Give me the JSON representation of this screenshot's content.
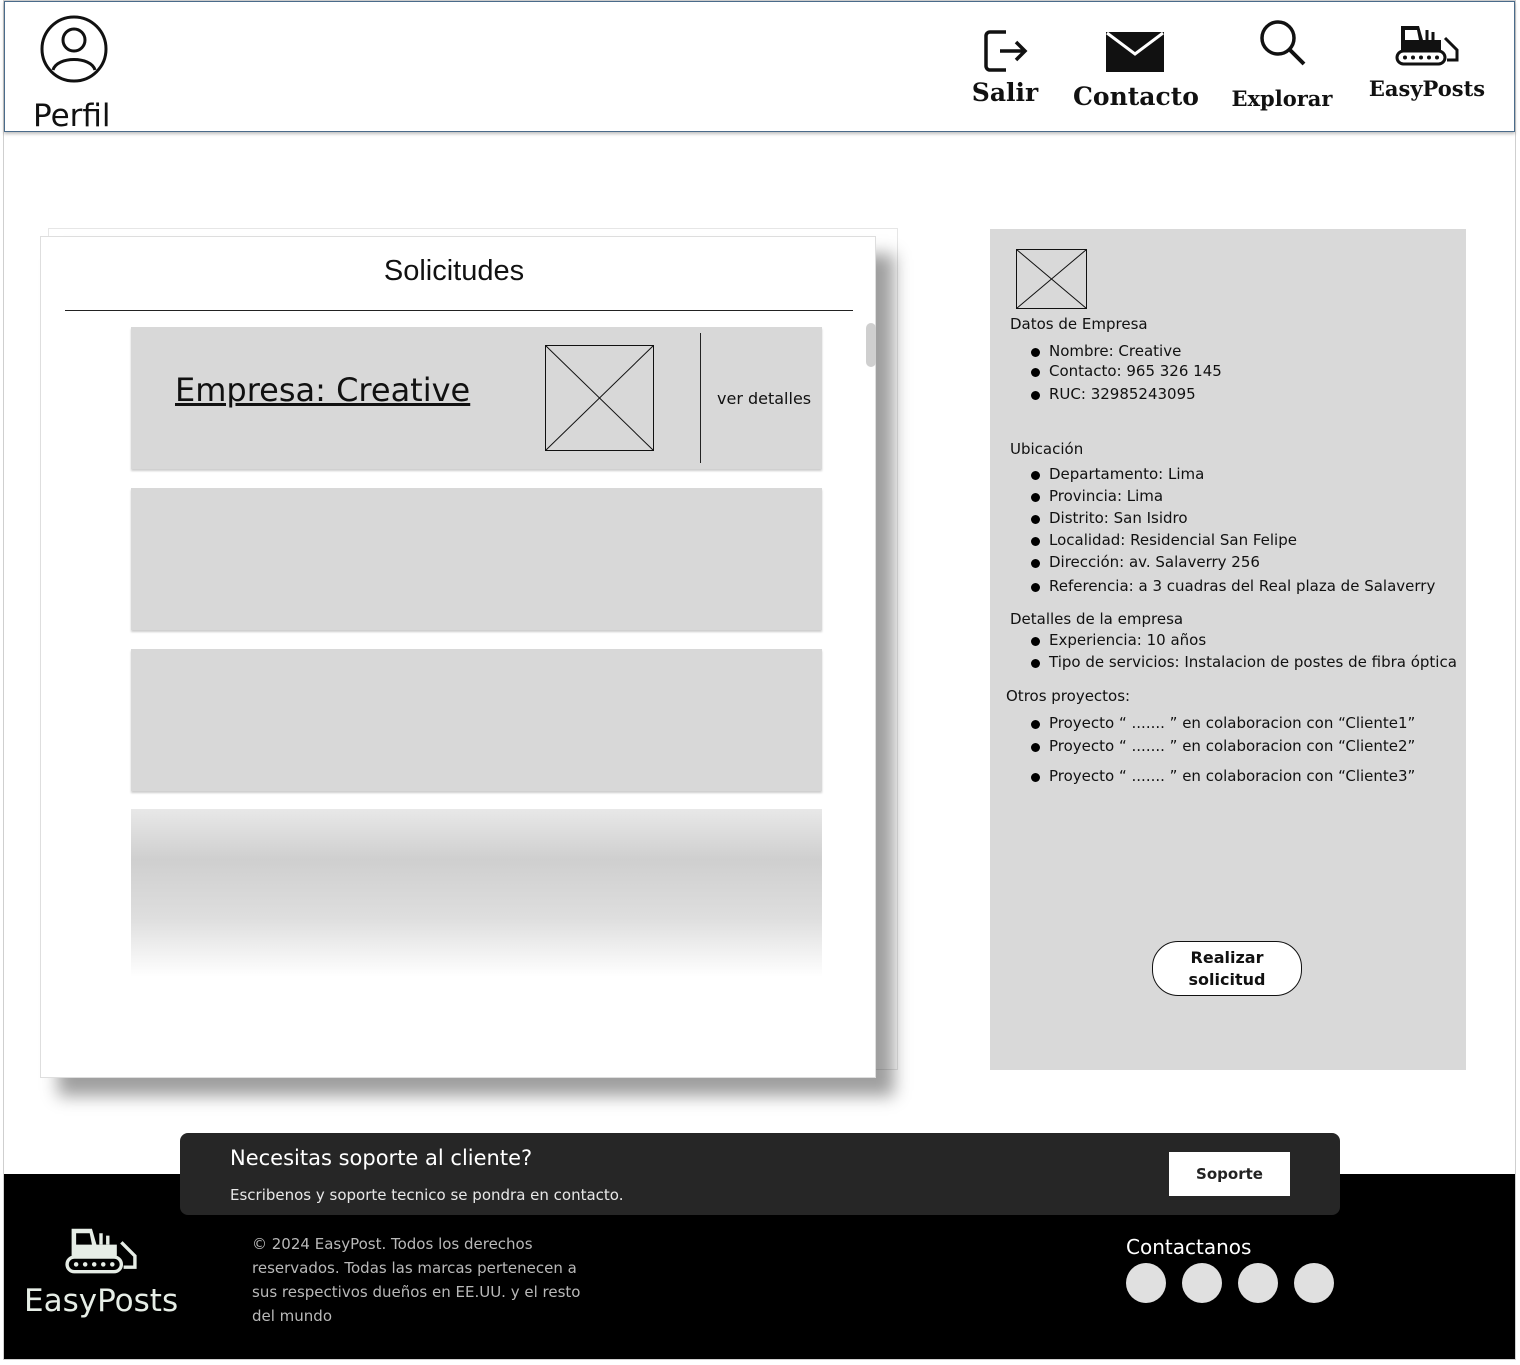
{
  "header": {
    "profile_label": "Perfil",
    "nav": [
      {
        "label": "Salir",
        "icon": "logout-icon"
      },
      {
        "label": "Contacto",
        "icon": "mail-icon"
      },
      {
        "label": "Explorar",
        "icon": "search-icon"
      },
      {
        "label": "EasyPosts",
        "icon": "bulldozer-icon"
      }
    ]
  },
  "solicitudes": {
    "title": "Solicitudes",
    "cards": [
      {
        "title": "Empresa: Creative",
        "link": "ver detalles"
      }
    ]
  },
  "info": {
    "sections": [
      {
        "title": "Datos de Empresa",
        "items": [
          "Nombre: Creative",
          "Contacto: 965 326 145",
          "RUC: 32985243095"
        ]
      },
      {
        "title": "Ubicación",
        "items": [
          "Departamento: Lima",
          "Provincia: Lima",
          "Distrito: San Isidro",
          "Localidad: Residencial San Felipe",
          "Dirección: av. Salaverry 256",
          "Referencia: a 3 cuadras del Real plaza de Salaverry"
        ]
      },
      {
        "title": "Detalles de la empresa",
        "items": [
          "Experiencia: 10 años",
          "Tipo de servicios: Instalacion de postes de fibra óptica"
        ]
      },
      {
        "title": "Otros proyectos:",
        "items": [
          "Proyecto “ ....... ” en colaboracion con “Cliente1”",
          "Proyecto “ ....... ” en colaboracion con “Cliente2”",
          "Proyecto “ ....... ” en colaboracion con “Cliente3”"
        ]
      }
    ],
    "button_label_line1": "Realizar",
    "button_label_line2": "solicitud"
  },
  "support": {
    "title": "Necesitas soporte al cliente?",
    "subtitle": "Escribenos y soporte tecnico se pondra en contacto.",
    "button": "Soporte"
  },
  "footer": {
    "brand": "EasyPosts",
    "copyright": "© 2024 EasyPost. Todos los derechos reservados. Todas las marcas pertenecen a sus respectivos dueños en EE.UU. y el resto del mundo",
    "contact_title": "Contactanos",
    "social_icons": [
      "social-icon-1",
      "social-icon-2",
      "social-icon-3",
      "social-icon-4"
    ]
  }
}
